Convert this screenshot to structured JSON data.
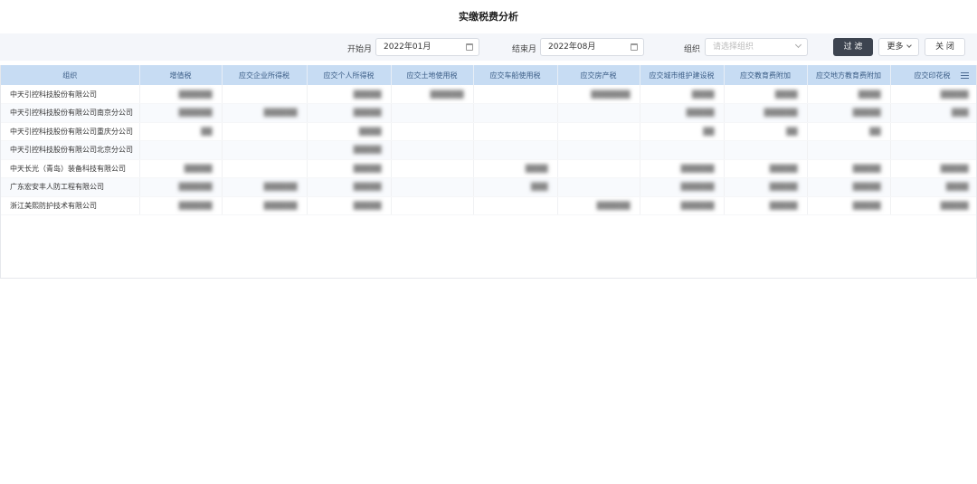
{
  "title": "实缴税费分析",
  "filters": {
    "start_label": "开始月",
    "start_value": "2022年01月",
    "end_label": "结束月",
    "end_value": "2022年08月",
    "org_label": "组织",
    "org_placeholder": "请选择组织"
  },
  "buttons": {
    "filter": "过 滤",
    "more": "更多",
    "close": "关 闭"
  },
  "table": {
    "columns": [
      "组织",
      "增值税",
      "应交企业所得税",
      "应交个人所得税",
      "应交土地使用税",
      "应交车船使用税",
      "应交房产税",
      "应交城市维护建设税",
      "应交教育费附加",
      "应交地方教育费附加",
      "应交印花税"
    ],
    "rows": [
      [
        "中天引控科技股份有限公司",
        "██████",
        "",
        "█████",
        "██████",
        "",
        "███████",
        "████",
        "████",
        "████",
        "█████"
      ],
      [
        "中天引控科技股份有限公司南京分公司",
        "██████",
        "██████",
        "█████",
        "",
        "",
        "",
        "█████",
        "██████",
        "█████",
        "███"
      ],
      [
        "中天引控科技股份有限公司重庆分公司",
        "██",
        "",
        "████",
        "",
        "",
        "",
        "██",
        "██",
        "██",
        ""
      ],
      [
        "中天引控科技股份有限公司北京分公司",
        "",
        "",
        "█████",
        "",
        "",
        "",
        "",
        "",
        "",
        ""
      ],
      [
        "中天长光（青岛）装备科技有限公司",
        "█████",
        "",
        "█████",
        "",
        "████",
        "",
        "██████",
        "█████",
        "█████",
        "█████"
      ],
      [
        "广东宏安丰人防工程有限公司",
        "██████",
        "██████",
        "█████",
        "",
        "███",
        "",
        "██████",
        "█████",
        "█████",
        "████"
      ],
      [
        "浙江美熙防护技术有限公司",
        "██████",
        "██████",
        "█████",
        "",
        "",
        "██████",
        "██████",
        "█████",
        "█████",
        "█████"
      ]
    ]
  }
}
